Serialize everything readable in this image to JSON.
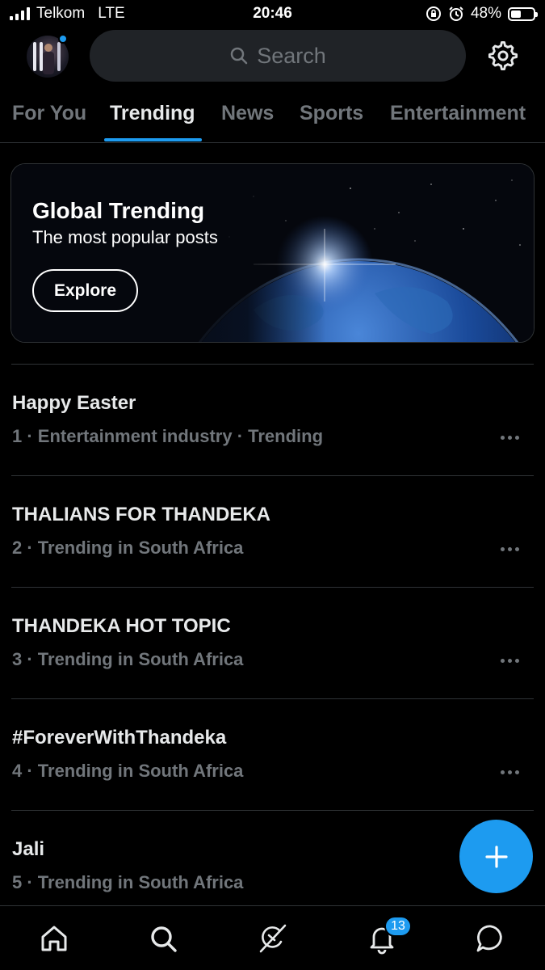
{
  "status_bar": {
    "carrier": "Telkom",
    "network": "LTE",
    "time": "20:46",
    "battery": "48%",
    "battery_level": 0.48
  },
  "header": {
    "search_placeholder": "Search"
  },
  "tabs": [
    {
      "label": "For You",
      "active": false
    },
    {
      "label": "Trending",
      "active": true
    },
    {
      "label": "News",
      "active": false
    },
    {
      "label": "Sports",
      "active": false
    },
    {
      "label": "Entertainment",
      "active": false
    }
  ],
  "banner": {
    "title": "Global Trending",
    "subtitle": "The most popular posts",
    "button_label": "Explore"
  },
  "trends": [
    {
      "title": "Happy Easter",
      "meta": "1 · Entertainment industry · Trending"
    },
    {
      "title": "THALIANS FOR THANDEKA",
      "meta": "2 · Trending in South Africa"
    },
    {
      "title": "THANDEKA HOT TOPIC",
      "meta": "3 · Trending in South Africa"
    },
    {
      "title": "#ForeverWithThandeka",
      "meta": "4 · Trending in South Africa"
    },
    {
      "title": "Jali",
      "meta": "5 · Trending in South Africa"
    }
  ],
  "bottom_nav": {
    "items": [
      {
        "icon": "home-icon"
      },
      {
        "icon": "search-icon"
      },
      {
        "icon": "grok-icon"
      },
      {
        "icon": "bell-icon"
      },
      {
        "icon": "messages-icon"
      }
    ],
    "notifications_badge": "13"
  },
  "colors": {
    "accent": "#1d9bf0",
    "background": "#000000",
    "muted_text": "#71767b",
    "primary_text": "#e7e9ea"
  }
}
